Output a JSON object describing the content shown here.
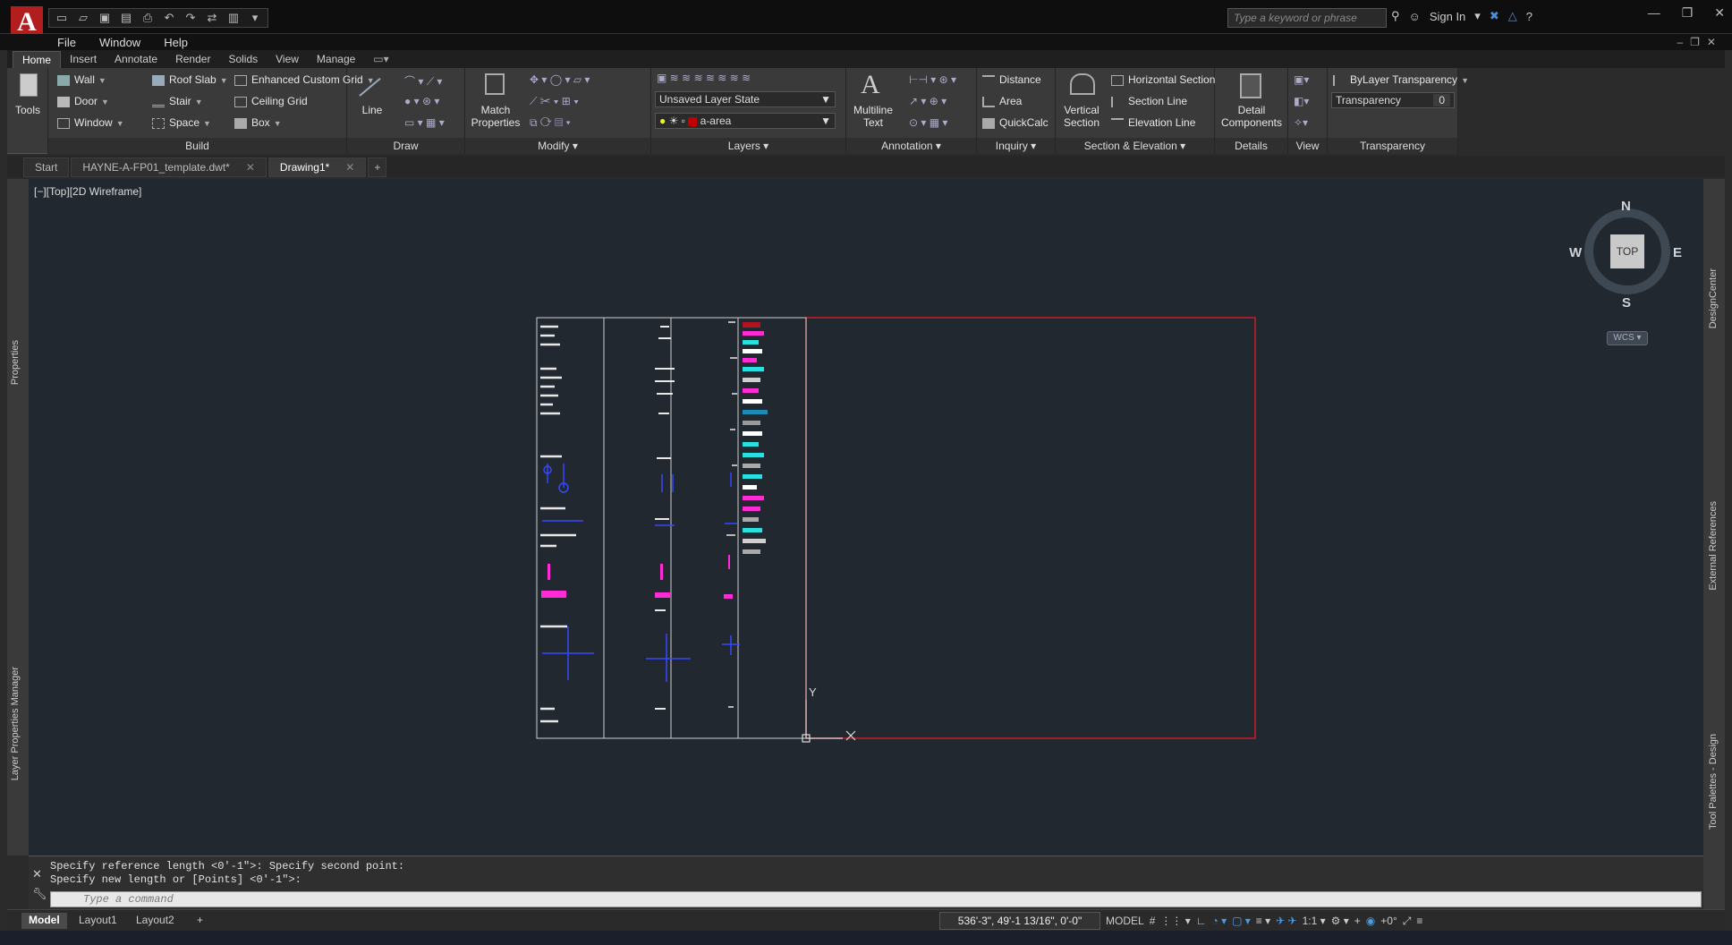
{
  "app": {
    "logo_letter": "A",
    "search_placeholder": "Type a keyword or phrase",
    "sign_in": "Sign In"
  },
  "menu": {
    "file": "File",
    "window": "Window",
    "help": "Help"
  },
  "ribbon_tabs": [
    "Home",
    "Insert",
    "Annotate",
    "Render",
    "Solids",
    "View",
    "Manage"
  ],
  "ribbon": {
    "tools": "Tools",
    "build": {
      "wall": "Wall",
      "door": "Door",
      "window": "Window",
      "roof_slab": "Roof Slab",
      "stair": "Stair",
      "space": "Space",
      "enhanced_custom_grid": "Enhanced Custom Grid",
      "ceiling_grid": "Ceiling Grid",
      "box": "Box",
      "label": "Build"
    },
    "draw": {
      "line": "Line",
      "label": "Draw"
    },
    "modify": {
      "match_properties_1": "Match",
      "match_properties_2": "Properties",
      "label": "Modify"
    },
    "layers": {
      "layer_state": "Unsaved Layer State",
      "current_layer": "a-area",
      "layer_color": "#c00000",
      "label": "Layers"
    },
    "annotation": {
      "multiline_1": "Multiline",
      "multiline_2": "Text",
      "label": "Annotation"
    },
    "inquiry": {
      "distance": "Distance",
      "area": "Area",
      "quickcalc": "QuickCalc",
      "label": "Inquiry"
    },
    "section": {
      "vertical_1": "Vertical",
      "vertical_2": "Section",
      "horizontal_section": "Horizontal Section",
      "section_line": "Section Line",
      "elevation_line": "Elevation Line",
      "label": "Section & Elevation"
    },
    "details": {
      "detail_1": "Detail",
      "detail_2": "Components",
      "label": "Details"
    },
    "view": {
      "label": "View"
    },
    "transparency": {
      "bylayer": "ByLayer Transparency",
      "field_label": "Transparency",
      "value": "0",
      "label": "Transparency"
    }
  },
  "doc_tabs": [
    {
      "label": "Start"
    },
    {
      "label": "HAYNE-A-FP01_template.dwt*"
    },
    {
      "label": "Drawing1*"
    }
  ],
  "viewport": {
    "label": "[−][Top][2D Wireframe]",
    "compass": {
      "n": "N",
      "s": "S",
      "e": "E",
      "w": "W",
      "top": "TOP",
      "wcs": "WCS"
    },
    "ucs_y": "Y"
  },
  "side_palettes": {
    "properties": "Properties",
    "layer_manager": "Layer Properties Manager",
    "design_center": "DesignCenter",
    "external_refs": "External References",
    "tool_palettes": "Tool Palettes - Design"
  },
  "command": {
    "line1": "Specify reference length <0'-1\">:  Specify second point:",
    "line2": "Specify new length or [Points] <0'-1\">:",
    "placeholder": "Type a command"
  },
  "layouts": [
    "Model",
    "Layout1",
    "Layout2"
  ],
  "status": {
    "coords": "536'-3\", 49'-1 13/16\", 0'-0\"",
    "mode": "MODEL",
    "scale": "1:1",
    "offset": "+0°"
  }
}
